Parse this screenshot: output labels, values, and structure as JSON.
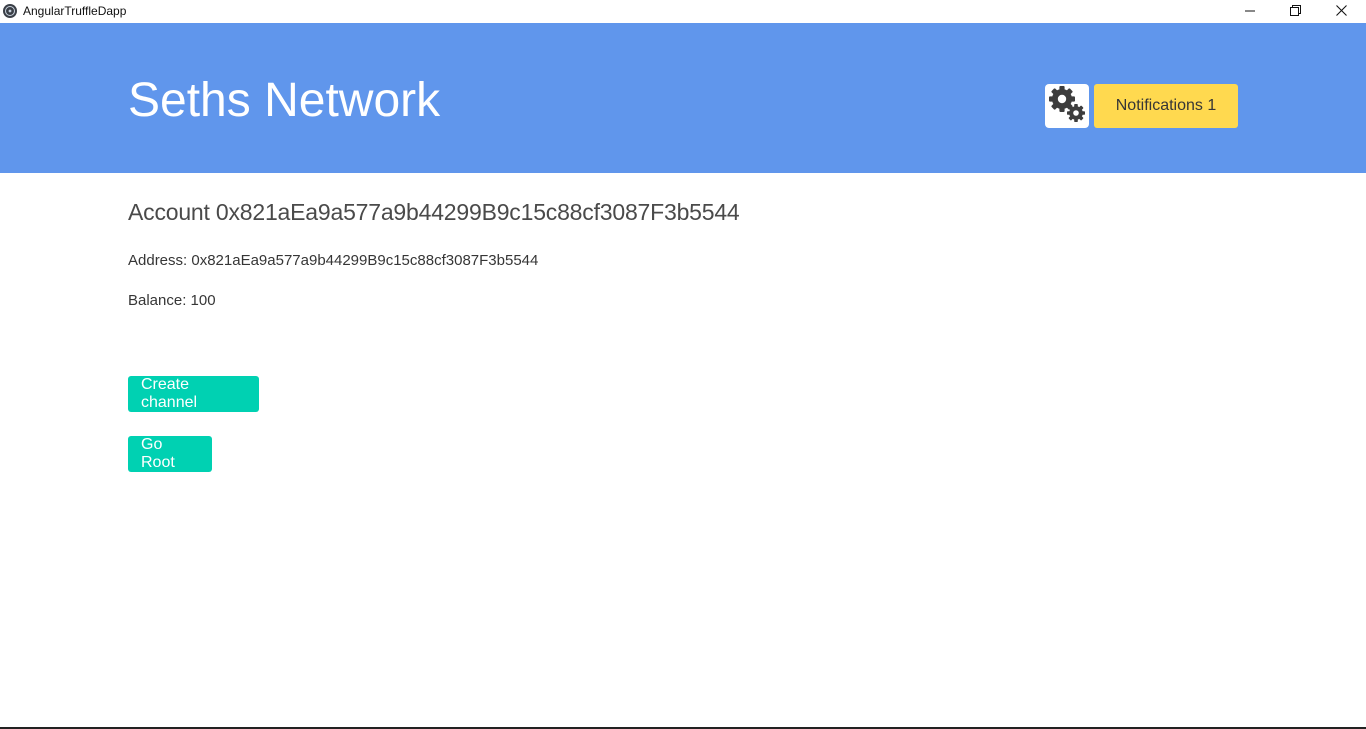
{
  "window": {
    "title": "AngularTruffleDapp",
    "controls": [
      "minimize-icon",
      "restore-icon",
      "close-icon"
    ]
  },
  "header": {
    "title": "Seths Network",
    "settings_icon": "gears-icon",
    "notifications_label": "Notifications 1",
    "colors": {
      "background": "#6096ec",
      "notifications": "#ffd94f"
    }
  },
  "account": {
    "heading": "Account 0x821aEa9a577a9b44299B9c15c88cf3087F3b5544",
    "address_line": "Address: 0x821aEa9a577a9b44299B9c15c88cf3087F3b5544",
    "balance_line": "Balance: 100"
  },
  "actions": {
    "create_channel_label": "Create channel",
    "go_root_label": "Go Root",
    "color": "#00d1b2"
  }
}
